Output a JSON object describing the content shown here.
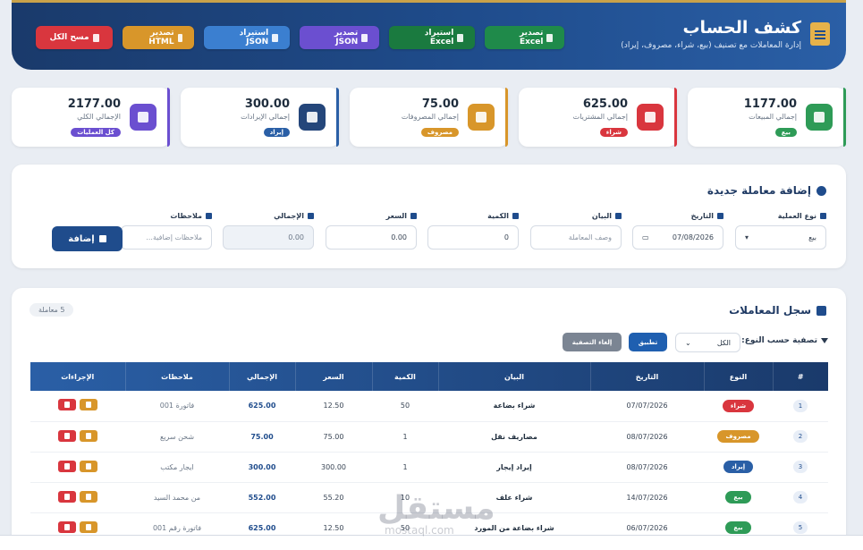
{
  "header": {
    "title": "كشف الحساب",
    "subtitle": "إدارة المعاملات مع تصنيف (بيع، شراء، مصروف، إيراد)",
    "buttons": [
      {
        "label": "تصدير Excel"
      },
      {
        "label": "استيراد Excel"
      },
      {
        "label": "تصدير JSON"
      },
      {
        "label": "استيراد JSON"
      },
      {
        "label": "تصدير HTML"
      },
      {
        "label": "مسح الكل"
      }
    ]
  },
  "stats": [
    {
      "value": "1177.00",
      "label": "إجمالي المبيعات",
      "badge": "بيع",
      "color": "#2e9b57"
    },
    {
      "value": "625.00",
      "label": "إجمالي المشتريات",
      "badge": "شراء",
      "color": "#d9363e"
    },
    {
      "value": "75.00",
      "label": "إجمالي المصروفات",
      "badge": "مصروف",
      "color": "#d8962a"
    },
    {
      "value": "300.00",
      "label": "إجمالي الإيرادات",
      "badge": "إيراد",
      "color": "#2a5fa6"
    },
    {
      "value": "2177.00",
      "label": "الإجمالي الكلي",
      "badge": "كل العمليات",
      "color": "#6b4fd0"
    }
  ],
  "form": {
    "title": "إضافة معاملة جديدة",
    "type_label": "نوع العملية",
    "type_value": "بيع",
    "date_label": "التاريخ",
    "date_value": "07/08/2026",
    "desc_label": "البيان",
    "desc_placeholder": "وصف المعاملة",
    "qty_label": "الكمية",
    "qty_value": "0",
    "price_label": "السعر",
    "price_value": "0.00",
    "total_label": "الإجمالي",
    "total_value": "0.00",
    "notes_label": "ملاحظات",
    "notes_placeholder": "ملاحظات إضافية...",
    "add_button": "إضافة"
  },
  "log": {
    "title": "سجل المعاملات",
    "count": "5 معاملة",
    "filter_label": "تصفية حسب النوع:",
    "filter_value": "الكل",
    "apply_button": "تطبيق",
    "clear_button": "إلغاء التصفية",
    "columns": [
      "#",
      "النوع",
      "التاريخ",
      "البيان",
      "الكمية",
      "السعر",
      "الإجمالي",
      "ملاحظات",
      "الإجراءات"
    ],
    "rows": [
      {
        "idx": "1",
        "type": "شراء",
        "color": "#d9363e",
        "date": "07/07/2026",
        "desc": "شراء بضاعة",
        "qty": "50",
        "price": "12.50",
        "total": "625.00",
        "note": "فاتورة 001"
      },
      {
        "idx": "2",
        "type": "مصروف",
        "color": "#d8962a",
        "date": "08/07/2026",
        "desc": "مصاريف نقل",
        "qty": "1",
        "price": "75.00",
        "total": "75.00",
        "note": "شحن سريع"
      },
      {
        "idx": "3",
        "type": "إيراد",
        "color": "#2a5fa6",
        "date": "08/07/2026",
        "desc": "إيراد إيجار",
        "qty": "1",
        "price": "300.00",
        "total": "300.00",
        "note": "ايجار مكتب"
      },
      {
        "idx": "4",
        "type": "بيع",
        "color": "#2e9b57",
        "date": "14/07/2026",
        "desc": "شراء علف",
        "qty": "10",
        "price": "55.20",
        "total": "552.00",
        "note": "من محمد السيد"
      },
      {
        "idx": "5",
        "type": "بيع",
        "color": "#2e9b57",
        "date": "06/07/2026",
        "desc": "شراء بضاعة من المورد",
        "qty": "50",
        "price": "12.50",
        "total": "625.00",
        "note": "فاتورة رقم 001"
      }
    ]
  },
  "watermark": {
    "text": "مستقل",
    "sub": "mostaql.com"
  }
}
